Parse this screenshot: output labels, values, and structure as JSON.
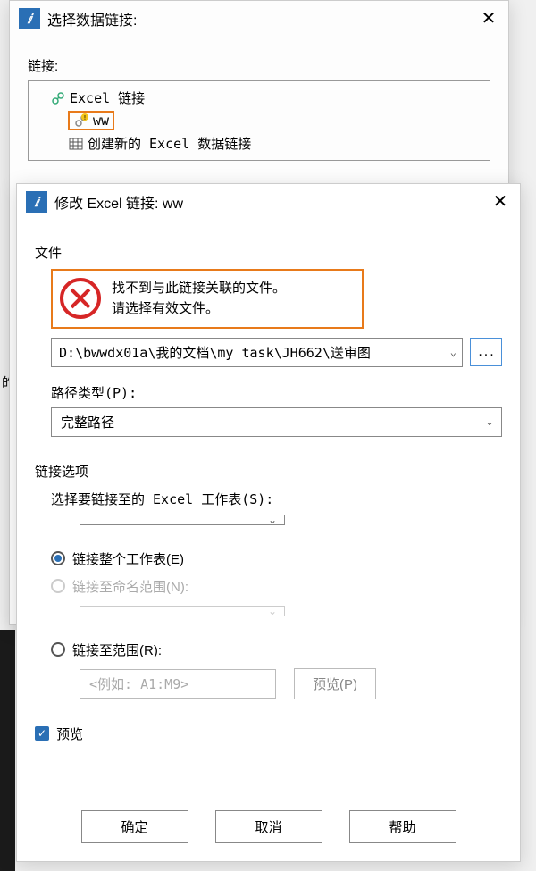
{
  "back_dialog": {
    "title": "选择数据链接:",
    "close_glyph": "✕",
    "link_label": "链接:",
    "tree": {
      "root": "Excel 链接",
      "item1": "ww",
      "item2": "创建新的 Excel 数据链接"
    }
  },
  "front_dialog": {
    "title": "修改 Excel 链接: ww",
    "close_glyph": "✕",
    "file_section": "文件",
    "error_line1": "找不到与此链接关联的文件。",
    "error_line2": "请选择有效文件。",
    "file_path": "D:\\bwwdx01a\\我的文档\\my task\\JH662\\送审图",
    "browse_glyph": "...",
    "path_type_label": "路径类型(P):",
    "path_type_value": "完整路径",
    "link_options_label": "链接选项",
    "sheet_label": "选择要链接至的 Excel 工作表(S):",
    "sheet_value": "",
    "radio_whole": "链接整个工作表(E)",
    "radio_named": "链接至命名范围(N):",
    "named_value": "",
    "radio_range": "链接至范围(R):",
    "range_placeholder": "<例如: A1:M9>",
    "preview_btn": "预览(P)",
    "preview_check": "预览",
    "ok": "确定",
    "cancel": "取消",
    "help": "帮助"
  },
  "side_char": "的",
  "chevron": "⌄"
}
